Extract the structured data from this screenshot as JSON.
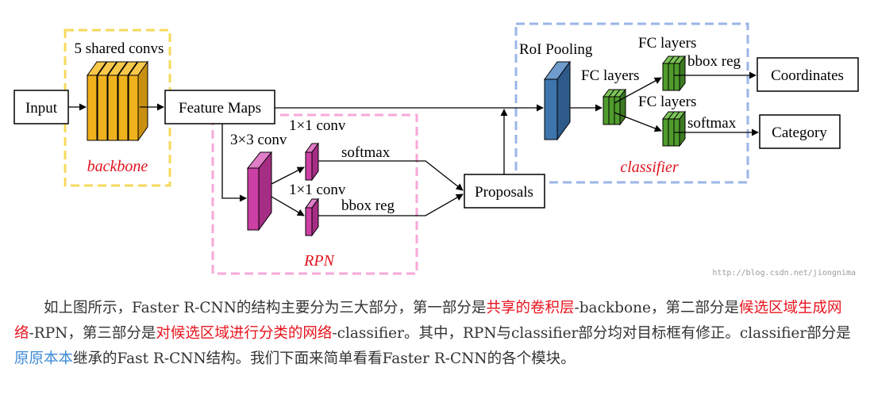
{
  "colors": {
    "backbone_box": "#f7d85b",
    "rpn_box": "#f7a8d8",
    "classifier_box": "#9bb6e8",
    "conv_block": "#f0b21c",
    "rpn_block": "#cc3fa4",
    "roi_block": "#3e75ad",
    "fc_block": "#4f9b2c",
    "caption": "#e0141e",
    "highlight_red": "#e8141e",
    "highlight_blue": "#3d8bd6"
  },
  "diagram": {
    "nodes": {
      "input": "Input",
      "feature_maps": "Feature Maps",
      "proposals": "Proposals",
      "coordinates": "Coordinates",
      "category": "Category"
    },
    "labels": {
      "shared_convs": "5 shared convs",
      "conv3x3": "3×3 conv",
      "conv1x1_top": "1×1 conv",
      "conv1x1_bottom": "1×1 conv",
      "softmax_rpn": "softmax",
      "bbox_reg_rpn": "bbox reg",
      "roi_pooling": "RoI Pooling",
      "fc_layers_1": "FC layers",
      "fc_layers_2": "FC layers",
      "fc_layers_3": "FC layers",
      "bbox_reg_cls": "bbox reg",
      "softmax_cls": "softmax"
    },
    "regions": {
      "backbone": "backbone",
      "rpn": "RPN",
      "classifier": "classifier"
    },
    "watermark": "http://blog.csdn.net/jiongnima"
  },
  "paragraph": {
    "p1": "如上图所示，Faster R-CNN的结构主要分为三大部分，第一部分是",
    "h1": "共享的卷积层",
    "p2": "-backbone，第二部分是",
    "h2": "候选区域生成网络",
    "p3": "-RPN，第三部分是",
    "h3": "对候选区域进行分类的网络",
    "p4": "-classifier。其中，RPN与classifier部分均对目标框有修正。classifier部分是",
    "h4": "原原本本",
    "p5": "继承的Fast R-CNN结构。我们下面来简单看看Faster R-CNN的各个模块。"
  }
}
